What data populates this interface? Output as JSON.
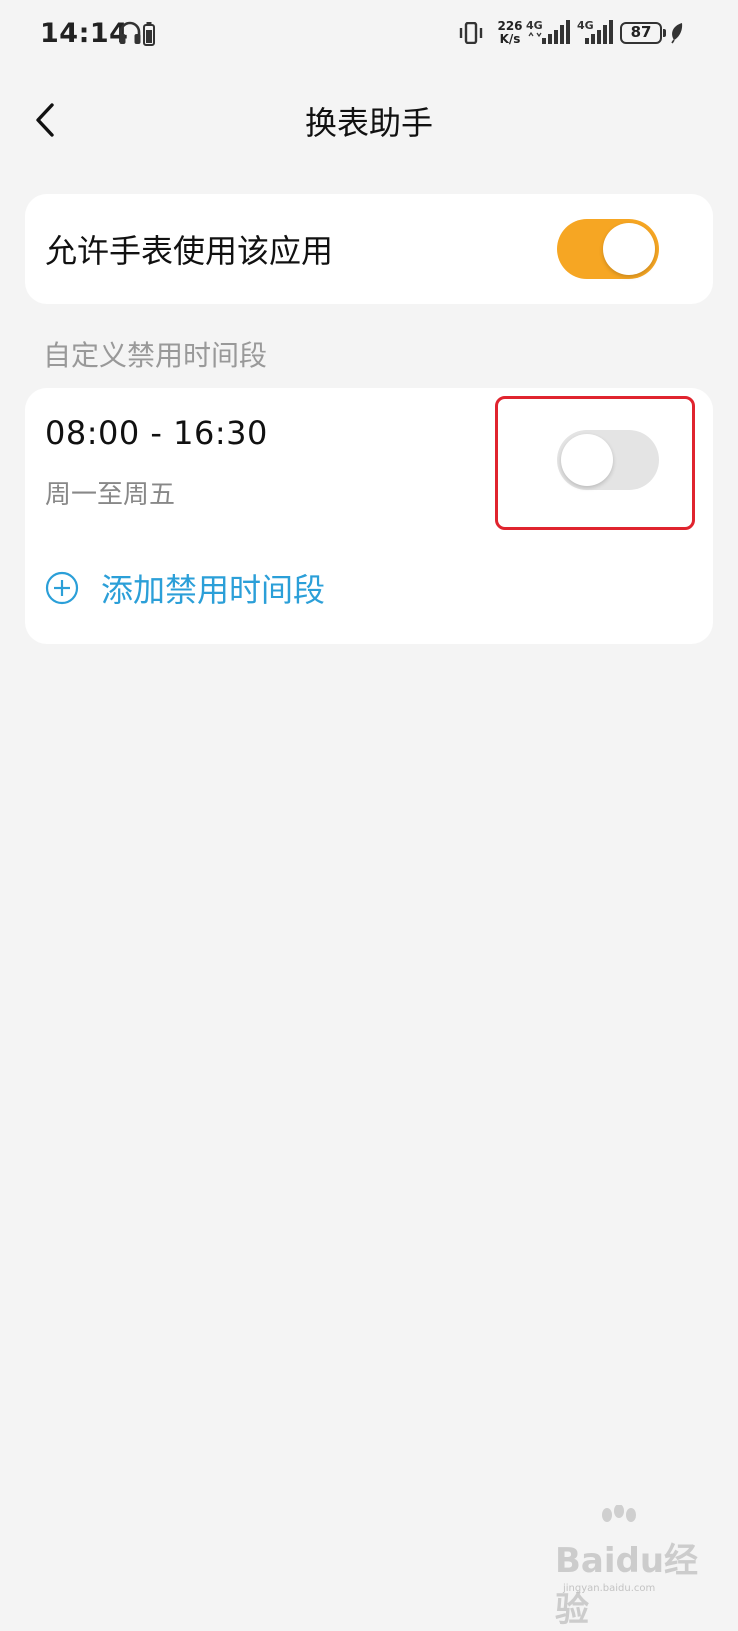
{
  "status_bar": {
    "time": "14:14",
    "net_speed_value": "226",
    "net_speed_unit": "K/s",
    "signal_1_label": "4G",
    "signal_2_label": "4G",
    "battery": "87"
  },
  "header": {
    "title": "换表助手"
  },
  "allow_card": {
    "label": "允许手表使用该应用",
    "enabled": true
  },
  "section": {
    "label": "自定义禁用时间段"
  },
  "periods": [
    {
      "time": "08:00 - 16:30",
      "days": "周一至周五",
      "enabled": false
    }
  ],
  "add_period": {
    "label": "添加禁用时间段"
  },
  "colors": {
    "accent_toggle": "#f6a623",
    "link_blue": "#2b9fd8",
    "highlight_red": "#e0242e",
    "background": "#f4f4f4"
  },
  "watermark": {
    "text": "Baidu经验",
    "sub": "jingyan.baidu.com"
  }
}
